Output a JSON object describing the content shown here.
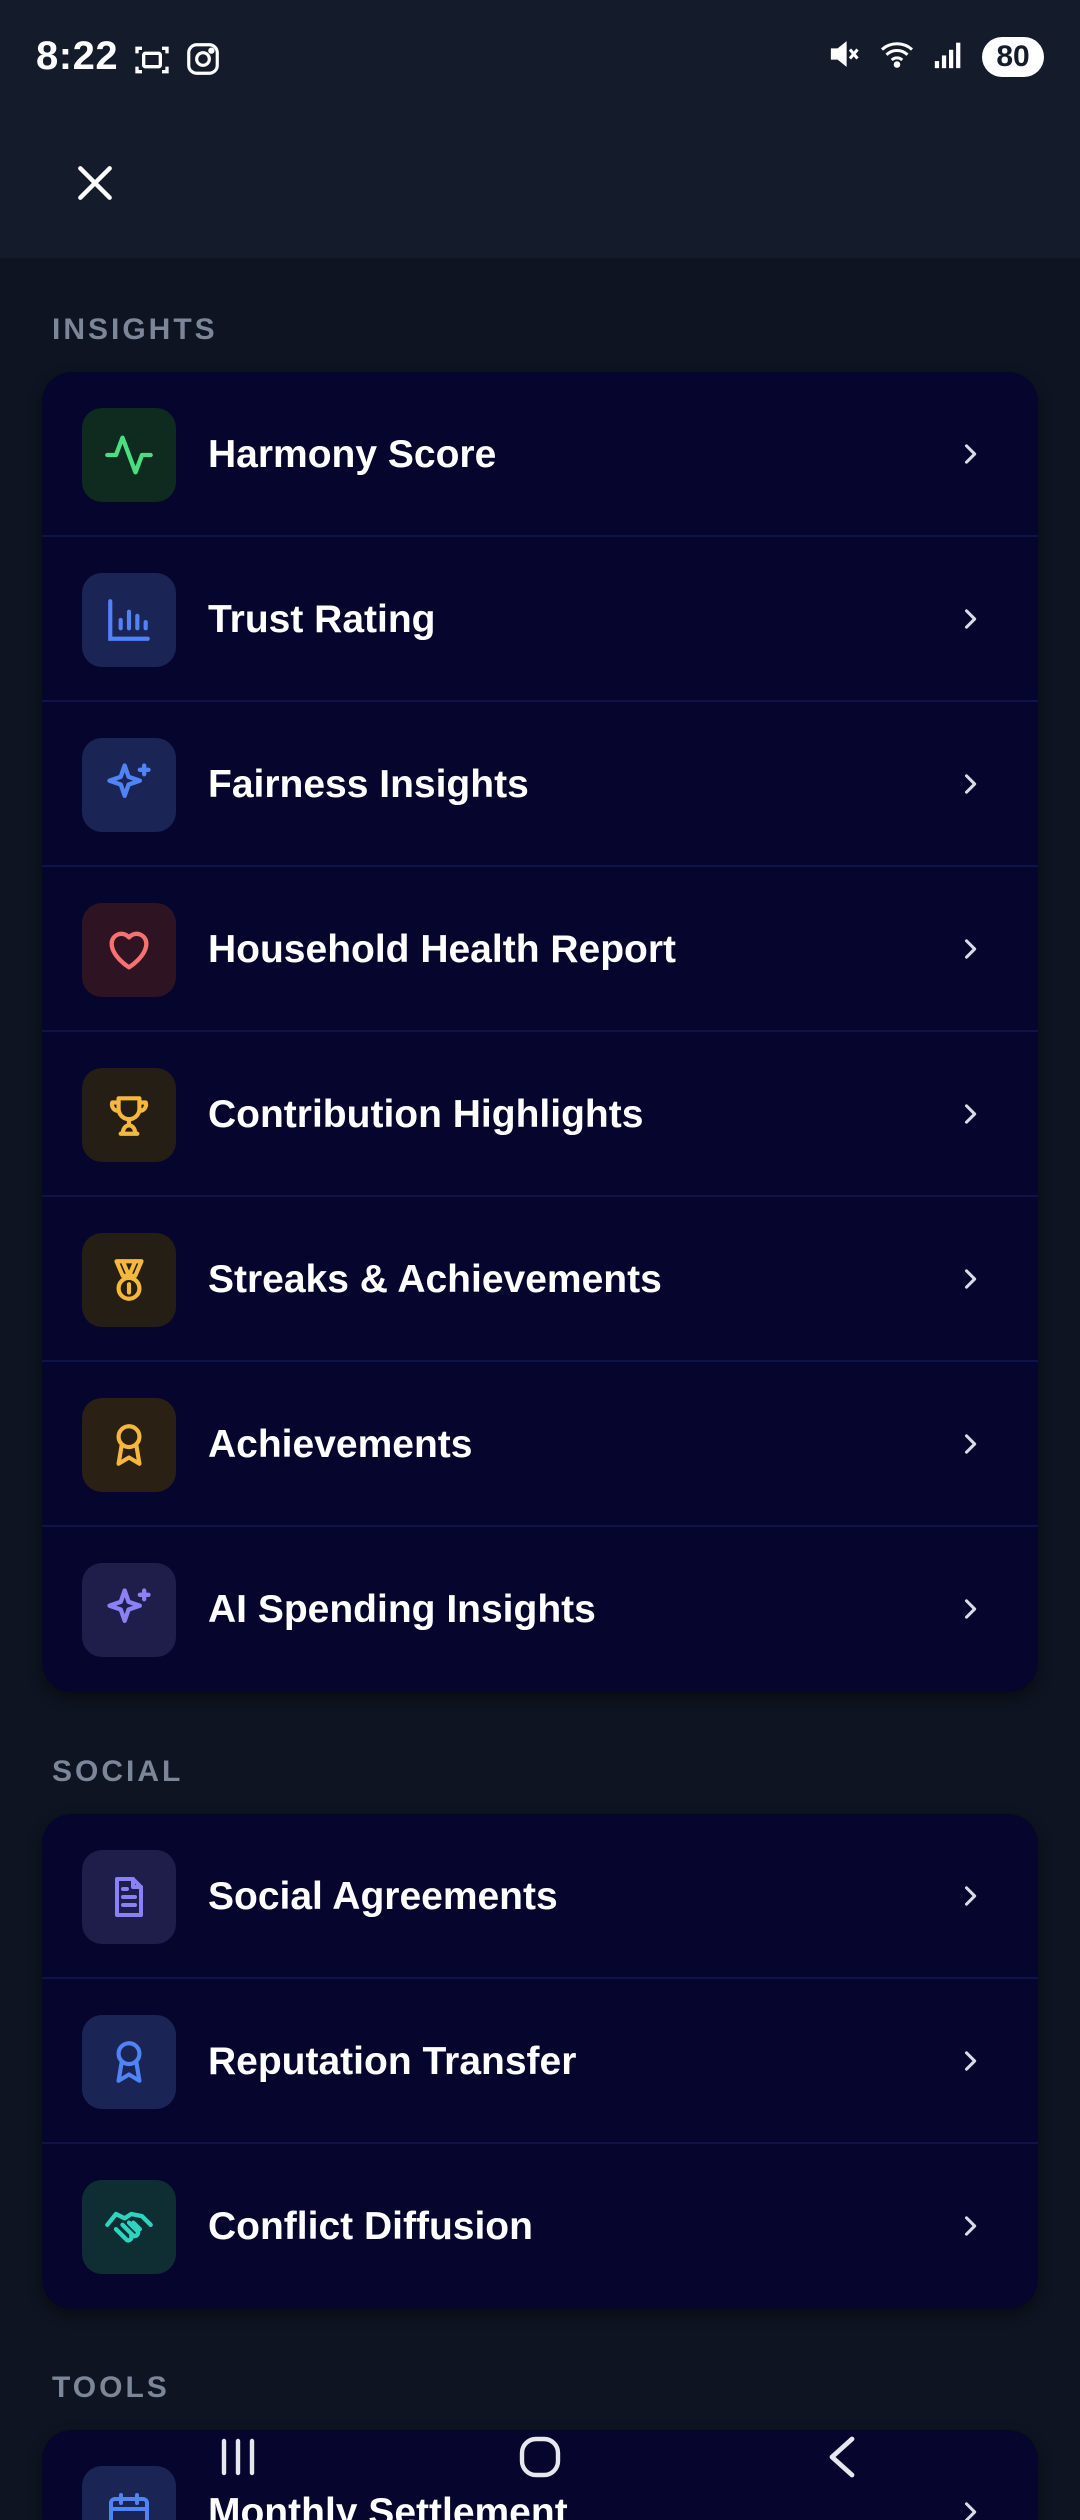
{
  "status": {
    "time": "8:22",
    "battery": "80"
  },
  "sections": [
    {
      "label": "INSIGHTS",
      "items": [
        {
          "label": "Harmony Score",
          "icon": "activity-icon",
          "color": "#4ade80",
          "bg": "#0f2a1e"
        },
        {
          "label": "Trust Rating",
          "icon": "bar-chart-icon",
          "color": "#4f83f6",
          "bg": "#1a2555"
        },
        {
          "label": "Fairness Insights",
          "icon": "sparkles-icon",
          "color": "#4f83f6",
          "bg": "#1a2555"
        },
        {
          "label": "Household Health Report",
          "icon": "heart-icon",
          "color": "#f87171",
          "bg": "#2e1422"
        },
        {
          "label": "Contribution Highlights",
          "icon": "trophy-icon",
          "color": "#f5b83d",
          "bg": "#241e14"
        },
        {
          "label": "Streaks & Achievements",
          "icon": "medal-icon",
          "color": "#f5b83d",
          "bg": "#241e14"
        },
        {
          "label": "Achievements",
          "icon": "award-icon",
          "color": "#f5b83d",
          "bg": "#2a2014"
        },
        {
          "label": "AI Spending Insights",
          "icon": "sparkles-icon",
          "color": "#8b80f5",
          "bg": "#1f1d4a"
        }
      ]
    },
    {
      "label": "SOCIAL",
      "items": [
        {
          "label": "Social Agreements",
          "icon": "document-icon",
          "color": "#8b80f5",
          "bg": "#1f1d4a"
        },
        {
          "label": "Reputation Transfer",
          "icon": "award-icon",
          "color": "#4f83f6",
          "bg": "#1a2555"
        },
        {
          "label": "Conflict Diffusion",
          "icon": "handshake-icon",
          "color": "#2dd4bf",
          "bg": "#0e2e34"
        }
      ]
    },
    {
      "label": "TOOLS",
      "items": [
        {
          "label": "Monthly Settlement",
          "icon": "calendar-icon",
          "color": "#4f83f6",
          "bg": "#1a2555"
        }
      ]
    }
  ]
}
